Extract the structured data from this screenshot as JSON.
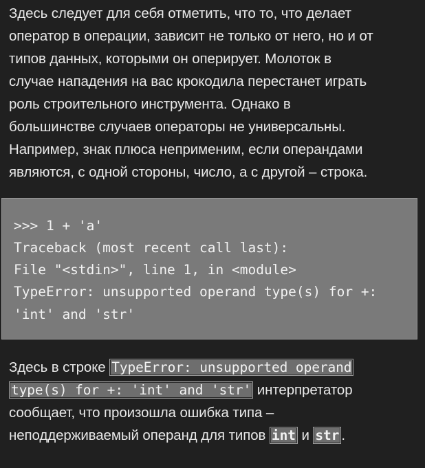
{
  "intro_paragraph": {
    "lines": [
      "Здесь следует для себя отметить, что то, что делает",
      "оператор в операции, зависит не только от него, но и от",
      "типов данных, которыми он оперирует. Молоток в",
      "случае нападения на вас крокодила перестанет играть",
      "роль строительного инструмента. Однако в",
      "большинстве случаев операторы не универсальны.",
      "Например, знак плюса неприменим, если операндами",
      "являются, с одной стороны, число, а с другой – строка."
    ]
  },
  "code_block": {
    "lines": [
      ">>> 1 + 'a'",
      "Traceback (most recent call last):",
      "File \"<stdin>\", line 1, in <module>",
      "TypeError: unsupported operand type(s) for +:",
      "'int' and 'str'"
    ]
  },
  "explanation_paragraph": {
    "prefix": "Здесь в строке ",
    "code_part1": "TypeError: unsupported operand",
    "code_part2": "type(s) for +: 'int' and 'str'",
    "after_code": " интерпретатор",
    "line3": "сообщает, что произошла ошибка типа –",
    "line4_prefix": "неподдерживаемый операнд для типов ",
    "type_int": "int",
    "conjunction": " и ",
    "type_str": "str",
    "end": "."
  },
  "colors": {
    "background": "#202020",
    "text": "#e8e8e8",
    "code_background": "#7a7a7a",
    "inline_code_background": "#6e6e6e"
  }
}
